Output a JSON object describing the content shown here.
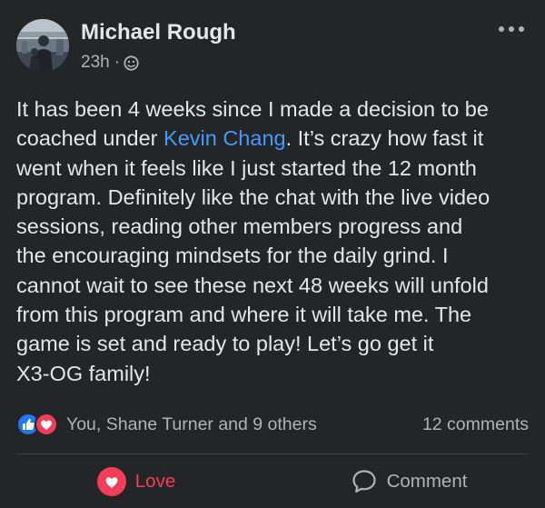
{
  "post": {
    "author": "Michael Rough",
    "timestamp": "23h",
    "meta_separator": "·",
    "audience_icon": "globe-icon",
    "more_icon": "more-dots-icon",
    "text_lines": [
      {
        "before": "It has been 4 weeks since I made a decision to be",
        "mention": "",
        "after": ""
      },
      {
        "before": "coached under ",
        "mention": "Kevin Chang",
        "after": ". It’s crazy how fast it"
      },
      {
        "before": "went when it feels like I just started the 12 month",
        "mention": "",
        "after": ""
      },
      {
        "before": "program. Definitely like the chat with the live video",
        "mention": "",
        "after": ""
      },
      {
        "before": "sessions, reading other members progress and",
        "mention": "",
        "after": ""
      },
      {
        "before": "the encouraging mindsets for the daily grind. I",
        "mention": "",
        "after": ""
      },
      {
        "before": "cannot wait to see these next 48 weeks will unfold",
        "mention": "",
        "after": ""
      },
      {
        "before": "from this program and where it will take me. The",
        "mention": "",
        "after": ""
      },
      {
        "before": "game is set and ready to play! Let’s go get it",
        "mention": "",
        "after": ""
      },
      {
        "before": "X3-OG family!",
        "mention": "",
        "after": ""
      }
    ]
  },
  "reactions": {
    "icons": [
      "like-icon",
      "love-icon"
    ],
    "summary": "You, Shane Turner and 9 others",
    "comment_count": "12 comments"
  },
  "actions": {
    "love_label": "Love",
    "comment_label": "Comment"
  },
  "colors": {
    "background": "#242526",
    "text_primary": "#e4e6eb",
    "text_secondary": "#b0b3b8",
    "mention": "#4599ff",
    "love": "#f33e58",
    "like": "#2078f4",
    "divider": "#3e4042"
  }
}
